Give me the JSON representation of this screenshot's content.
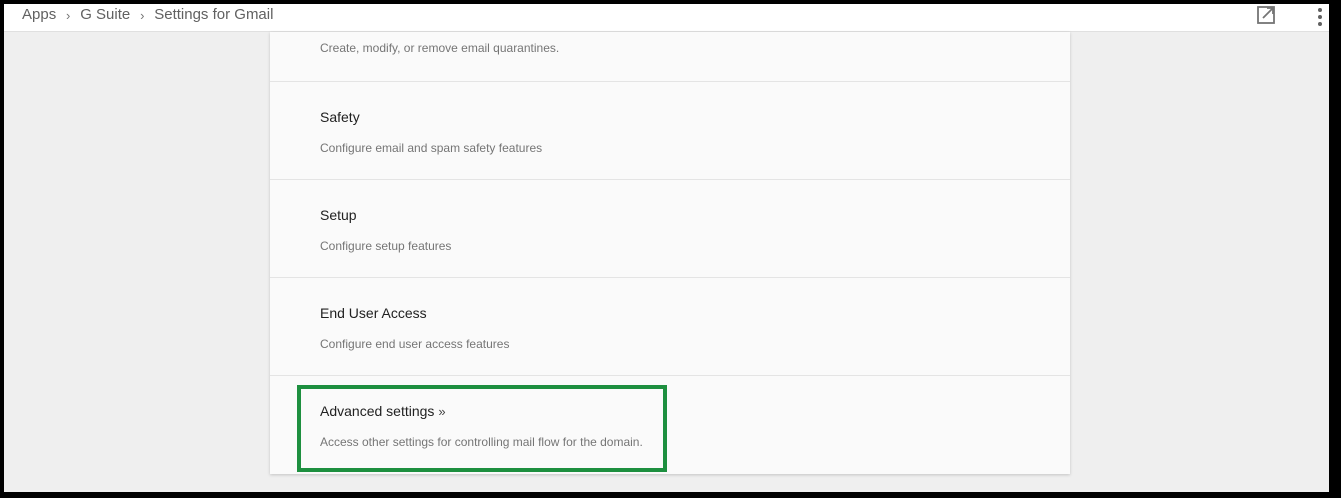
{
  "breadcrumb": {
    "items": [
      "Apps",
      "G Suite"
    ],
    "current": "Settings for Gmail",
    "separator": "›"
  },
  "toolbar": {
    "open_icon": "open-in-new-icon",
    "more_icon": "more-vert-icon"
  },
  "settings": {
    "quarantine": {
      "description": "Create, modify, or remove email quarantines."
    },
    "safety": {
      "title": "Safety",
      "description": "Configure email and spam safety features"
    },
    "setup": {
      "title": "Setup",
      "description": "Configure setup features"
    },
    "end_user_access": {
      "title": "End User Access",
      "description": "Configure end user access features"
    },
    "advanced": {
      "title": "Advanced settings",
      "chevron": "»",
      "description": "Access other settings for controlling mail flow for the domain."
    }
  },
  "colors": {
    "highlight": "#1d8f3f",
    "background": "#efefef",
    "card": "#fafafa"
  }
}
